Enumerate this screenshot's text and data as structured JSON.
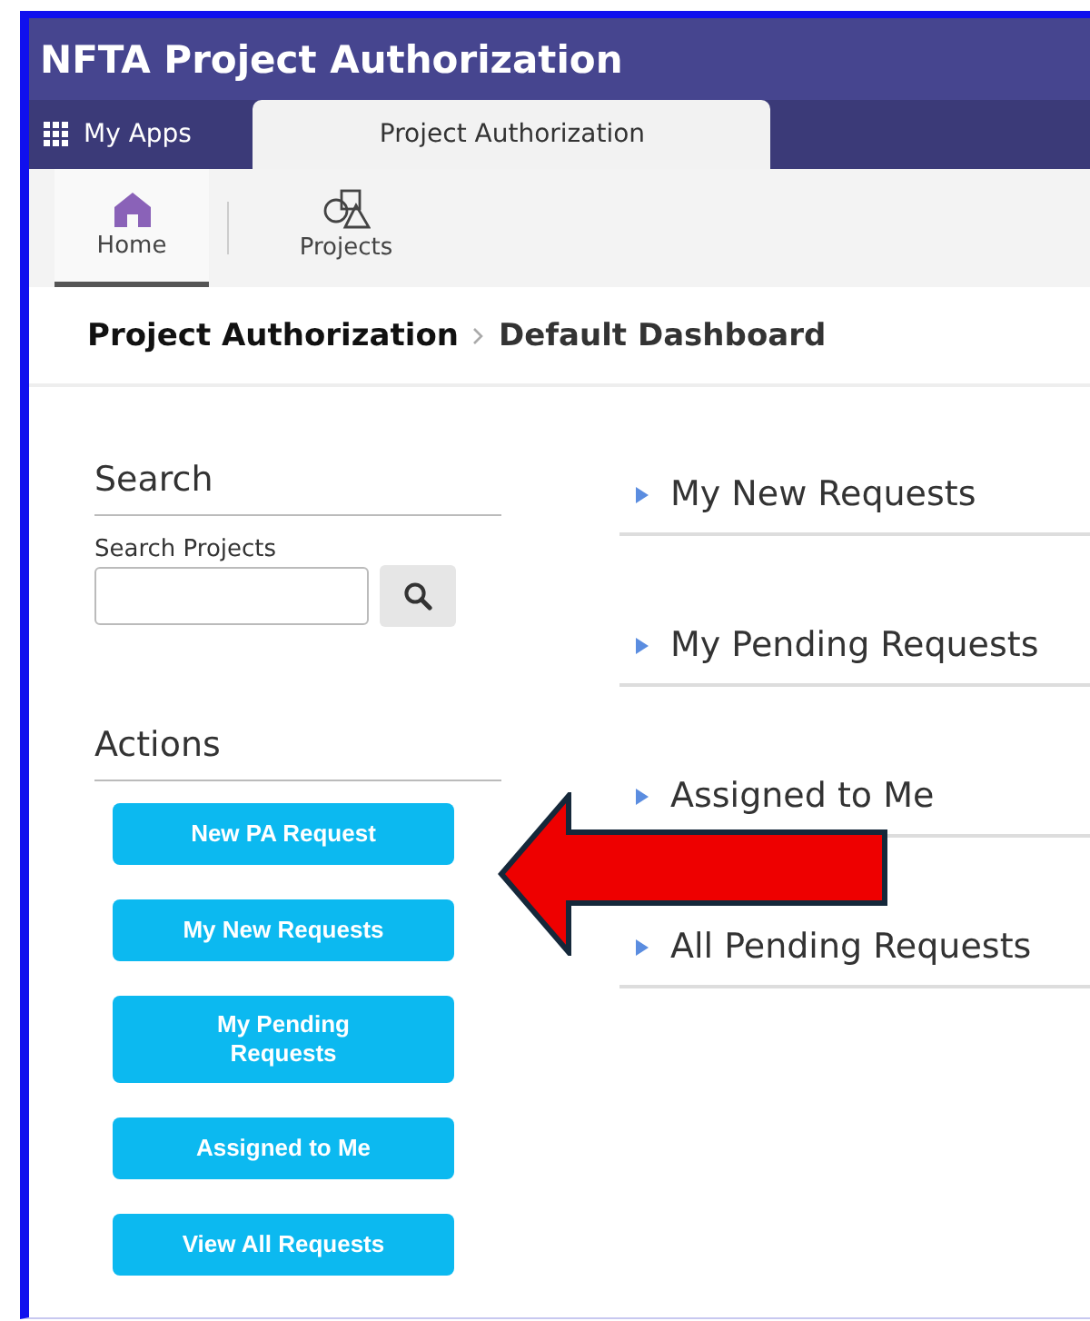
{
  "window": {
    "title": "NFTA Project Authorization"
  },
  "app_tabs": [
    {
      "label": "My Apps",
      "kind": "launcher",
      "selected": false
    },
    {
      "label": "Project Authorization",
      "kind": "tab",
      "selected": true
    }
  ],
  "nav": [
    {
      "label": "Home",
      "kind": "home",
      "selected": true
    },
    {
      "label": "Projects",
      "kind": "shapes",
      "selected": false
    }
  ],
  "breadcrumb": [
    "Project Authorization",
    "Default Dashboard"
  ],
  "search": {
    "heading": "Search",
    "label": "Search Projects"
  },
  "actions": {
    "heading": "Actions",
    "buttons": [
      "New PA Request",
      "My New Requests",
      "My Pending Requests",
      "Assigned to Me",
      "View All Requests"
    ]
  },
  "sections": [
    {
      "label": "My New Requests",
      "expanded": false
    },
    {
      "label": "My Pending Requests",
      "expanded": false
    },
    {
      "label": "Assigned to Me",
      "expanded": false
    },
    {
      "label": "All Pending Requests",
      "expanded": false
    }
  ]
}
